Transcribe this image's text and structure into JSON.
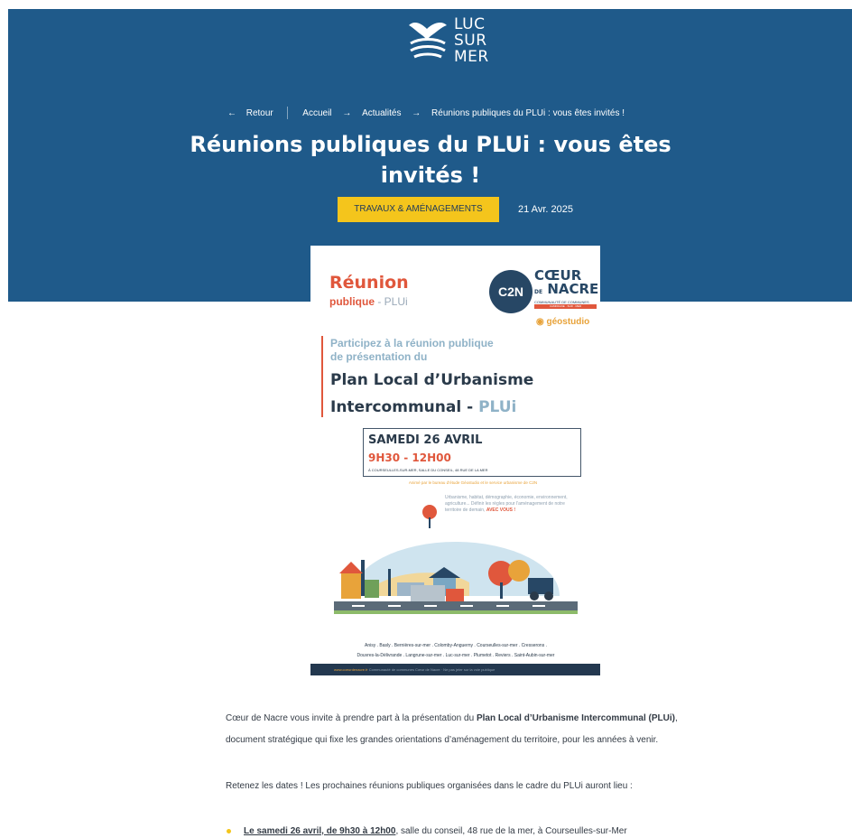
{
  "logo": {
    "line1": "LUC",
    "line2": "SUR",
    "line3": "MER"
  },
  "breadcrumb": {
    "back_arrow": "←",
    "back": "Retour",
    "home": "Accueil",
    "arrow": "→",
    "news": "Actualités",
    "current": "Réunions publiques du PLUi : vous êtes invités !"
  },
  "article": {
    "title": "Réunions publiques du PLUi : vous êtes invités !",
    "category": "Travaux & aménagements",
    "date": "21 Avr. 2025"
  },
  "poster": {
    "reunion": "Réunion",
    "publique": "publique",
    "plui_small": "- PLUi",
    "c2n": "C2N",
    "coeur": "CŒUR",
    "de": "DE",
    "nacre": "NACRE",
    "communaute": "COMMUNAUTÉ DE COMMUNES",
    "campagne": "CAMPAGNE · SUR · MER",
    "geostudio": "géostudio",
    "participez": "Participez à la réunion publique",
    "presentation": "de présentation du",
    "plan": "Plan Local d’Urbanisme",
    "inter": "Intercommunal -",
    "plui": "PLUi",
    "date_line": "SAMEDI 26 AVRIL",
    "time_line": "9H30 - 12H00",
    "place_line": "À COURSEULLES-SUR-MER, SALLE DU CONSEIL, 48 RUE DE LA MER",
    "anime": "Animé par le bureau d’étude Géostudio et le service urbanisme de C2N",
    "topics": "Urbanisme, habitat, démographie, économie, environnement, agriculture... Définir les règles pour l’aménagement de notre territoire de demain,",
    "avec_vous": "AVEC VOUS !",
    "towns_1": "Anisy . Basly . Bernières-sur-mer . Colomby-Anguerny . Courseulles-sur-mer . Cresserons .",
    "towns_2": "Douvres-la-Délivrande . Langrune-sur-mer . Luc-sur-mer . Plumetot . Reviers . Saint-Aubin-sur-mer",
    "footer_site": "www.coeurdenacre.fr",
    "footer_rest": "Communauté de communes Cœur de Nacre · Ne pas jeter sur la voie publique"
  },
  "body": {
    "p1_before": "Cœur de Nacre vous invite à prendre part à la présentation du ",
    "p1_bold": "Plan Local d’Urbanisme Intercommunal (PLUi)",
    "p1_after": ",",
    "p2": "document stratégique qui fixe les grandes orientations d’aménagement du territoire, pour les années à venir.",
    "p3": "Retenez les dates ! Les prochaines réunions publiques organisées dans le cadre du PLUi auront lieu :",
    "li1_bold": "Le samedi 26 avril, de 9h30 à 12h00",
    "li1_rest": ", salle du conseil, 48 rue de la mer, à Courseulles-sur-Mer"
  },
  "colors": {
    "header_bg": "#1f5a8a",
    "tag_bg": "#f4c51c",
    "accent": "#e0573c",
    "bullet": "#f4c51c"
  }
}
